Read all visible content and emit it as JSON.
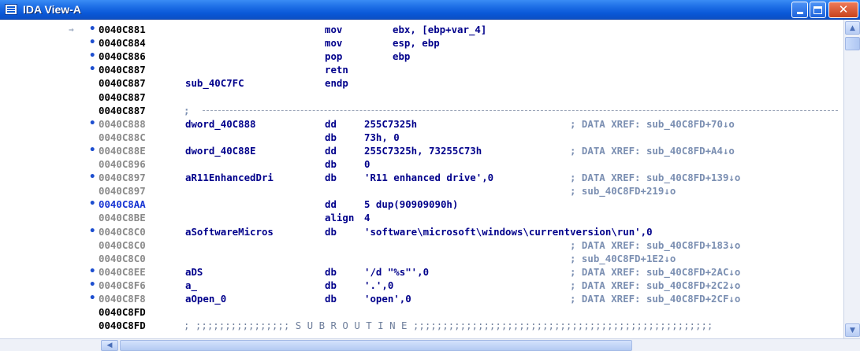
{
  "window": {
    "title": "IDA View-A",
    "close_glyph": "✕",
    "scroll_up": "▲",
    "scroll_down": "▼",
    "scroll_left": "◀"
  },
  "lines": [
    {
      "addr": "0040C881",
      "mn": "mov",
      "op": "ebx, [ebp+var_4]"
    },
    {
      "addr": "0040C884",
      "mn": "mov",
      "op": "esp, ebp"
    },
    {
      "addr": "0040C886",
      "mn": "pop",
      "op": "ebp"
    },
    {
      "addr": "0040C887",
      "mn": "retn"
    },
    {
      "addr": "0040C887",
      "label": "sub_40C7FC",
      "mn": "endp"
    },
    {
      "addr": "0040C887"
    },
    {
      "addr": "0040C887",
      "sep": ";"
    },
    {
      "addr": "0040C888",
      "label": "dword_40C888",
      "mn": "dd",
      "op": "255C7325h",
      "comment": "; DATA XREF: sub_40C8FD+70↓o"
    },
    {
      "addr": "0040C88C",
      "mn": "db",
      "op": "73h, 0"
    },
    {
      "addr": "0040C88E",
      "label": "dword_40C88E",
      "mn": "dd",
      "op": "255C7325h, 73255C73h",
      "comment": "; DATA XREF: sub_40C8FD+A4↓o"
    },
    {
      "addr": "0040C896",
      "mn": "db",
      "op": "0"
    },
    {
      "addr": "0040C897",
      "label": "aR11EnhancedDri",
      "mn": "db",
      "op": "'R11 enhanced drive',0",
      "comment": "; DATA XREF: sub_40C8FD+139↓o"
    },
    {
      "addr": "0040C897",
      "comment": "; sub_40C8FD+219↓o"
    },
    {
      "addr": "0040C8AA",
      "mn": "dd",
      "op": "5 dup(90909090h)"
    },
    {
      "addr": "0040C8BE",
      "mn": "align",
      "op": "4"
    },
    {
      "addr": "0040C8C0",
      "label": "aSoftwareMicros",
      "mn": "db",
      "op": "'software\\microsoft\\windows\\currentversion\\run',0"
    },
    {
      "addr": "0040C8C0",
      "comment": "; DATA XREF: sub_40C8FD+183↓o"
    },
    {
      "addr": "0040C8C0",
      "comment": "; sub_40C8FD+1E2↓o"
    },
    {
      "addr": "0040C8EE",
      "label": "aDS",
      "mn": "db",
      "op": "'/d \"%s\"',0",
      "comment": "; DATA XREF: sub_40C8FD+2AC↓o"
    },
    {
      "addr": "0040C8F6",
      "label": "a_",
      "mn": "db",
      "op": "'.',0",
      "comment": "; DATA XREF: sub_40C8FD+2C2↓o"
    },
    {
      "addr": "0040C8F8",
      "label": "aOpen_0",
      "mn": "db",
      "op": "'open',0",
      "comment": "; DATA XREF: sub_40C8FD+2CF↓o"
    },
    {
      "addr": "0040C8FD"
    },
    {
      "addr": "0040C8FD",
      "subr": "; ;;;;;;;;;;;;;;;; S U B R O U T I N E ;;;;;;;;;;;;;;;;;;;;;;;;;;;;;;;;;;;;;;;;;;;;;;;;;;;"
    }
  ]
}
